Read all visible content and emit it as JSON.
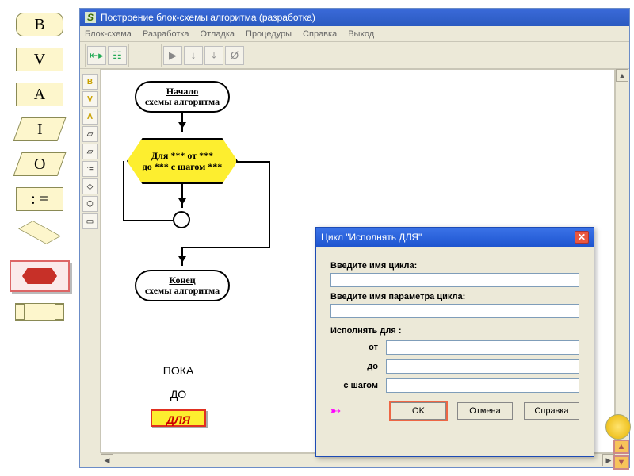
{
  "palette": {
    "b": "B",
    "v": "V",
    "a": "A",
    "i": "I",
    "o": "O",
    "assign": ":  ="
  },
  "app": {
    "title": "Построение блок-схемы алгоритма (разработка)",
    "icon_letter": "S",
    "menu": [
      "Блок-схема",
      "Разработка",
      "Отладка",
      "Процедуры",
      "Справка",
      "Выход"
    ]
  },
  "flowchart": {
    "start_kw": "Начало",
    "start_text": "схемы алгоритма",
    "for_line1": "Для *** от ***",
    "for_line2": "до *** с шагом ***",
    "end_kw": "Конец",
    "end_text": "схемы алгоритма"
  },
  "modes": {
    "while": "ПОКА",
    "until": "ДО",
    "for": "ДЛЯ"
  },
  "dialog": {
    "title": "Цикл \"Исполнять ДЛЯ\"",
    "label_name": "Введите имя цикла:",
    "label_param": "Введите имя параметра цикла:",
    "label_exec": "Исполнять для   :",
    "row_from": "от",
    "row_to": "до",
    "row_step": "с шагом",
    "ok": "OK",
    "cancel": "Отмена",
    "help": "Справка",
    "val_name": "",
    "val_param": "",
    "val_from": "",
    "val_to": "",
    "val_step": ""
  }
}
